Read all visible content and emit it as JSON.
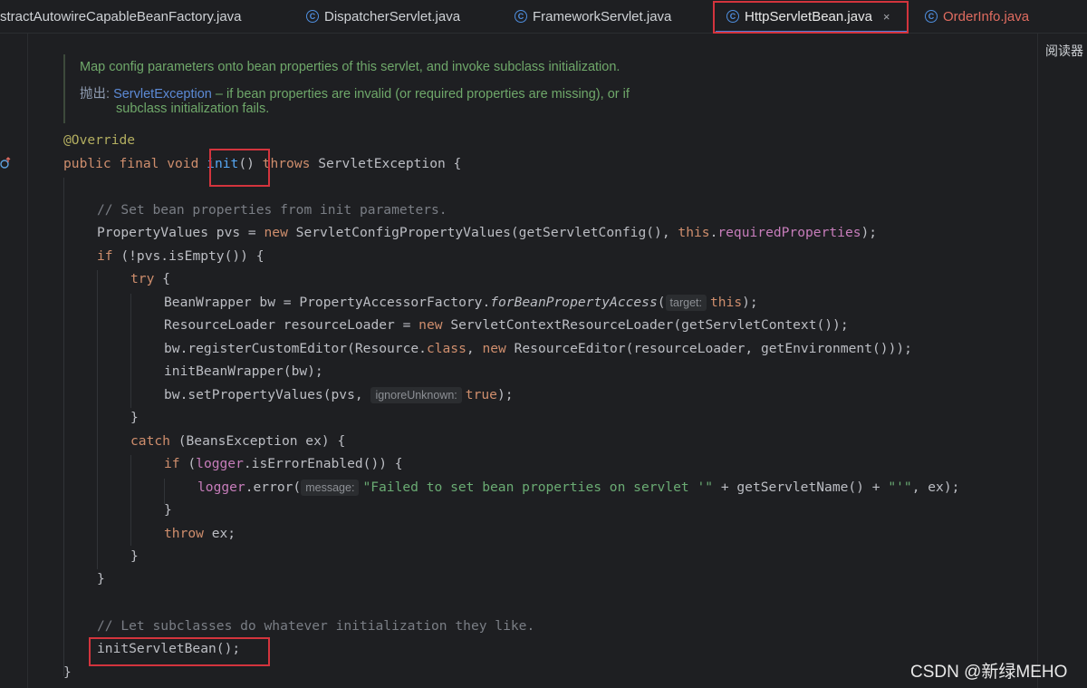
{
  "tabs": [
    {
      "label": "stractAutowireCapableBeanFactory.java",
      "active": false,
      "modified": false
    },
    {
      "label": "DispatcherServlet.java",
      "active": false,
      "modified": false
    },
    {
      "label": "FrameworkServlet.java",
      "active": false,
      "modified": false
    },
    {
      "label": "HttpServletBean.java",
      "active": true,
      "modified": false
    },
    {
      "label": "OrderInfo.java",
      "active": false,
      "modified": true
    }
  ],
  "tab_icon_glyph": "C",
  "close_glyph": "×",
  "reader_label": "阅读器",
  "doc": {
    "line1": "Map config parameters onto bean properties of this servlet, and invoke subclass initialization.",
    "throws_tag": "抛出:",
    "exception_link": "ServletException",
    "line2_rest": " – if bean properties are invalid (or required properties are missing), or if",
    "line3": "subclass initialization fails."
  },
  "code": {
    "l1_annotation": "@Override",
    "l2_kw": "public final void ",
    "l2_method": "init",
    "l2_parens": "()",
    "l2_throws": " throws",
    "l2_rest": " ServletException {",
    "l3_comment": "// Set bean properties from init parameters.",
    "l4_a": "PropertyValues pvs = ",
    "l4_new": "new",
    "l4_b": " ServletConfigPropertyValues(getServletConfig(), ",
    "l4_this": "this",
    "l4_dot": ".",
    "l4_field": "requiredProperties",
    "l4_end": ");",
    "l5_if": "if",
    "l5_rest": " (!pvs.isEmpty()) {",
    "l6_try": "try",
    "l6_rest": " {",
    "l7_a": "BeanWrapper bw = PropertyAccessorFactory.",
    "l7_static": "forBeanPropertyAccess",
    "l7_paren": "(",
    "l7_hint": "target:",
    "l7_this": "this",
    "l7_end": ");",
    "l8_a": "ResourceLoader resourceLoader = ",
    "l8_new": "new",
    "l8_b": " ServletContextResourceLoader(getServletContext());",
    "l9_a": "bw.registerCustomEditor(Resource.",
    "l9_class": "class",
    "l9_comma": ", ",
    "l9_new": "new",
    "l9_b": " ResourceEditor(resourceLoader, getEnvironment()));",
    "l10": "initBeanWrapper(bw);",
    "l11_a": "bw.setPropertyValues(pvs, ",
    "l11_hint": "ignoreUnknown:",
    "l11_true": "true",
    "l11_end": ");",
    "l12": "}",
    "l13_catch": "catch",
    "l13_rest": " (BeansException ex) {",
    "l14_if": "if",
    "l14_a": " (",
    "l14_field": "logger",
    "l14_b": ".isErrorEnabled()) {",
    "l15_field": "logger",
    "l15_a": ".error(",
    "l15_hint": "message:",
    "l15_str1": "\"Failed to set bean properties on servlet '\"",
    "l15_b": " + getServletName() + ",
    "l15_str2": "\"'\"",
    "l15_end": ", ex);",
    "l16": "}",
    "l17_throw": "throw",
    "l17_rest": " ex;",
    "l18": "}",
    "l19": "}",
    "l20_comment": "// Let subclasses do whatever initialization they like.",
    "l21": "initServletBean();",
    "l22": "}"
  },
  "watermark": "CSDN @新绿MEHO",
  "colors": {
    "background": "#1e1f22",
    "keyword": "#cf8e6d",
    "annotation": "#b3ae60",
    "comment": "#7a7e85",
    "string": "#6aab73",
    "field": "#c77dbb",
    "highlight_box": "#d3343d"
  }
}
